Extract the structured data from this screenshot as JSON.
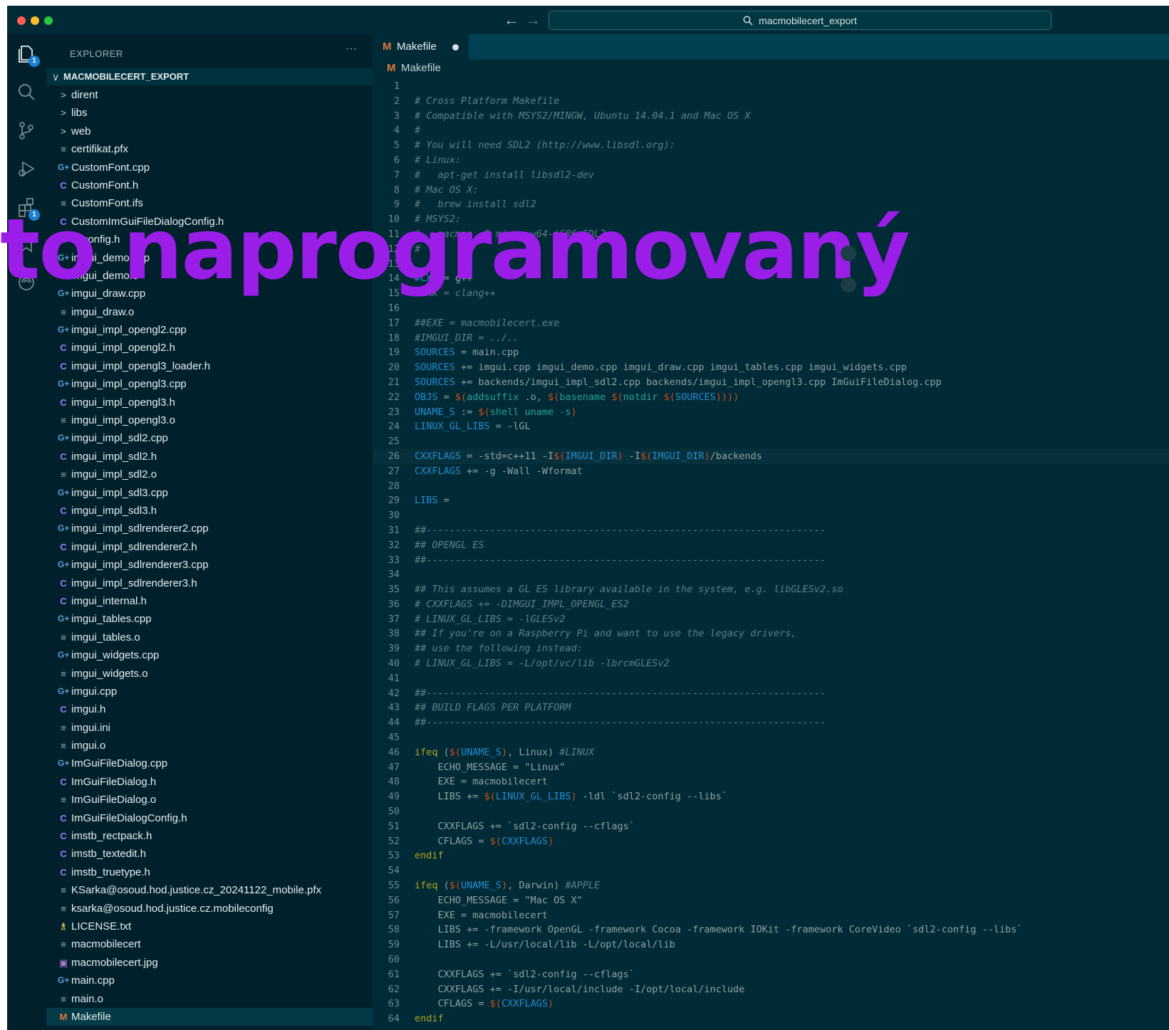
{
  "titlebar": {
    "search_text": "macmobilecert_export",
    "colors": {
      "close": "#ff5f57",
      "minimize": "#febc2e",
      "zoom": "#28c840"
    }
  },
  "activity_bar": {
    "items": [
      {
        "icon": "files-icon",
        "badge": "1"
      },
      {
        "icon": "search-icon"
      },
      {
        "icon": "source-control-icon"
      },
      {
        "icon": "run-debug-icon"
      },
      {
        "icon": "extensions-icon",
        "badge": "1"
      },
      {
        "icon": "bookmark-icon"
      },
      {
        "icon": "remote-icon"
      }
    ]
  },
  "sidebar": {
    "title": "EXPLORER",
    "more": "···",
    "root": "MACMOBILECERT_EXPORT",
    "files": [
      {
        "type": "folder",
        "icon": ">",
        "name": "dirent"
      },
      {
        "type": "folder",
        "icon": ">",
        "name": "libs"
      },
      {
        "type": "folder",
        "icon": ">",
        "name": "web"
      },
      {
        "type": "txt",
        "icon": "≡",
        "name": "certifikat.pfx"
      },
      {
        "type": "cpp",
        "icon": "G+",
        "name": "CustomFont.cpp"
      },
      {
        "type": "c",
        "icon": "C",
        "name": "CustomFont.h"
      },
      {
        "type": "txt",
        "icon": "≡",
        "name": "CustomFont.ifs"
      },
      {
        "type": "c",
        "icon": "C",
        "name": "CustomImGuiFileDialogConfig.h"
      },
      {
        "type": "c",
        "icon": "C",
        "name": "imconfig.h"
      },
      {
        "type": "cpp",
        "icon": "G+",
        "name": "imgui_demo.cpp"
      },
      {
        "type": "txt",
        "icon": "≡",
        "name": "imgui_demo.o"
      },
      {
        "type": "cpp",
        "icon": "G+",
        "name": "imgui_draw.cpp"
      },
      {
        "type": "txt",
        "icon": "≡",
        "name": "imgui_draw.o"
      },
      {
        "type": "cpp",
        "icon": "G+",
        "name": "imgui_impl_opengl2.cpp"
      },
      {
        "type": "c",
        "icon": "C",
        "name": "imgui_impl_opengl2.h"
      },
      {
        "type": "c",
        "icon": "C",
        "name": "imgui_impl_opengl3_loader.h"
      },
      {
        "type": "cpp",
        "icon": "G+",
        "name": "imgui_impl_opengl3.cpp"
      },
      {
        "type": "c",
        "icon": "C",
        "name": "imgui_impl_opengl3.h"
      },
      {
        "type": "txt",
        "icon": "≡",
        "name": "imgui_impl_opengl3.o"
      },
      {
        "type": "cpp",
        "icon": "G+",
        "name": "imgui_impl_sdl2.cpp"
      },
      {
        "type": "c",
        "icon": "C",
        "name": "imgui_impl_sdl2.h"
      },
      {
        "type": "txt",
        "icon": "≡",
        "name": "imgui_impl_sdl2.o"
      },
      {
        "type": "cpp",
        "icon": "G+",
        "name": "imgui_impl_sdl3.cpp"
      },
      {
        "type": "c",
        "icon": "C",
        "name": "imgui_impl_sdl3.h"
      },
      {
        "type": "cpp",
        "icon": "G+",
        "name": "imgui_impl_sdlrenderer2.cpp"
      },
      {
        "type": "c",
        "icon": "C",
        "name": "imgui_impl_sdlrenderer2.h"
      },
      {
        "type": "cpp",
        "icon": "G+",
        "name": "imgui_impl_sdlrenderer3.cpp"
      },
      {
        "type": "c",
        "icon": "C",
        "name": "imgui_impl_sdlrenderer3.h"
      },
      {
        "type": "c",
        "icon": "C",
        "name": "imgui_internal.h"
      },
      {
        "type": "cpp",
        "icon": "G+",
        "name": "imgui_tables.cpp"
      },
      {
        "type": "txt",
        "icon": "≡",
        "name": "imgui_tables.o"
      },
      {
        "type": "cpp",
        "icon": "G+",
        "name": "imgui_widgets.cpp"
      },
      {
        "type": "txt",
        "icon": "≡",
        "name": "imgui_widgets.o"
      },
      {
        "type": "cpp",
        "icon": "G+",
        "name": "imgui.cpp"
      },
      {
        "type": "c",
        "icon": "C",
        "name": "imgui.h"
      },
      {
        "type": "txt",
        "icon": "≡",
        "name": "imgui.ini"
      },
      {
        "type": "txt",
        "icon": "≡",
        "name": "imgui.o"
      },
      {
        "type": "cpp",
        "icon": "G+",
        "name": "ImGuiFileDialog.cpp"
      },
      {
        "type": "c",
        "icon": "C",
        "name": "ImGuiFileDialog.h"
      },
      {
        "type": "txt",
        "icon": "≡",
        "name": "ImGuiFileDialog.o"
      },
      {
        "type": "c",
        "icon": "C",
        "name": "ImGuiFileDialogConfig.h"
      },
      {
        "type": "c",
        "icon": "C",
        "name": "imstb_rectpack.h"
      },
      {
        "type": "c",
        "icon": "C",
        "name": "imstb_textedit.h"
      },
      {
        "type": "c",
        "icon": "C",
        "name": "imstb_truetype.h"
      },
      {
        "type": "txt",
        "icon": "≡",
        "name": "KSarka@osoud.hod.justice.cz_20241122_mobile.pfx"
      },
      {
        "type": "txt",
        "icon": "≡",
        "name": "ksarka@osoud.hod.justice.cz.mobileconfig"
      },
      {
        "type": "lic",
        "icon": "♗",
        "name": "LICENSE.txt"
      },
      {
        "type": "txt",
        "icon": "≡",
        "name": "macmobilecert"
      },
      {
        "type": "img",
        "icon": "▣",
        "name": "macmobilecert.jpg"
      },
      {
        "type": "cpp",
        "icon": "G+",
        "name": "main.cpp"
      },
      {
        "type": "txt",
        "icon": "≡",
        "name": "main.o"
      },
      {
        "type": "mk",
        "icon": "M",
        "name": "Makefile",
        "active": true
      }
    ]
  },
  "tab": {
    "icon": "M",
    "label": "Makefile",
    "dirty": true
  },
  "breadcrumb": {
    "icon": "M",
    "label": "Makefile"
  },
  "editor": {
    "lines": [
      {
        "n": "1",
        "t": []
      },
      {
        "n": "2",
        "t": [
          [
            "cm",
            "# Cross Platform Makefile"
          ]
        ]
      },
      {
        "n": "3",
        "t": [
          [
            "cm",
            "# Compatible with MSYS2/MINGW, Ubuntu 14.04.1 and Mac OS X"
          ]
        ]
      },
      {
        "n": "4",
        "t": [
          [
            "cm",
            "#"
          ]
        ]
      },
      {
        "n": "5",
        "t": [
          [
            "cm",
            "# You will need SDL2 (http://www.libsdl.org):"
          ]
        ]
      },
      {
        "n": "6",
        "t": [
          [
            "cm",
            "# Linux:"
          ]
        ]
      },
      {
        "n": "7",
        "t": [
          [
            "cm",
            "#   apt-get install libsdl2-dev"
          ]
        ]
      },
      {
        "n": "8",
        "t": [
          [
            "cm",
            "# Mac OS X:"
          ]
        ]
      },
      {
        "n": "9",
        "t": [
          [
            "cm",
            "#   brew install sdl2"
          ]
        ]
      },
      {
        "n": "10",
        "t": [
          [
            "cm",
            "# MSYS2:"
          ]
        ]
      },
      {
        "n": "11",
        "t": [
          [
            "cm",
            "#   pacman -S mingw-w64-i686-SDL2"
          ]
        ]
      },
      {
        "n": "12",
        "t": [
          [
            "cm",
            "#"
          ]
        ]
      },
      {
        "n": "13",
        "t": []
      },
      {
        "n": "14",
        "t": [
          [
            "vr",
            "#CXX"
          ],
          [
            "st",
            " = g++"
          ]
        ]
      },
      {
        "n": "15",
        "t": [
          [
            "cm",
            "#CXX = clang++"
          ]
        ]
      },
      {
        "n": "16",
        "t": []
      },
      {
        "n": "17",
        "t": [
          [
            "cm",
            "##EXE = macmobilecert.exe"
          ]
        ]
      },
      {
        "n": "18",
        "t": [
          [
            "cm",
            "#IMGUI_DIR = ../.."
          ]
        ]
      },
      {
        "n": "19",
        "t": [
          [
            "vr",
            "SOURCES"
          ],
          [
            "st",
            " = main.cpp"
          ]
        ]
      },
      {
        "n": "20",
        "t": [
          [
            "vr",
            "SOURCES"
          ],
          [
            "st",
            " += imgui.cpp imgui_demo.cpp imgui_draw.cpp imgui_tables.cpp imgui_widgets.cpp"
          ]
        ]
      },
      {
        "n": "21",
        "t": [
          [
            "vr",
            "SOURCES"
          ],
          [
            "st",
            " += backends/imgui_impl_sdl2.cpp backends/imgui_impl_opengl3.cpp ImGuiFileDialog.cpp"
          ]
        ]
      },
      {
        "n": "22",
        "t": [
          [
            "vr",
            "OBJS"
          ],
          [
            "st",
            " = "
          ],
          [
            "dl",
            "$("
          ],
          [
            "fn",
            "addsuffix"
          ],
          [
            "st",
            " .o, "
          ],
          [
            "dl",
            "$("
          ],
          [
            "fn",
            "basename"
          ],
          [
            "st",
            " "
          ],
          [
            "dl",
            "$("
          ],
          [
            "fn",
            "notdir"
          ],
          [
            "st",
            " "
          ],
          [
            "dl",
            "$("
          ],
          [
            "vr",
            "SOURCES"
          ],
          [
            "dl",
            "))))"
          ]
        ]
      },
      {
        "n": "23",
        "t": [
          [
            "vr",
            "UNAME_S"
          ],
          [
            "st",
            " := "
          ],
          [
            "dl",
            "$("
          ],
          [
            "fn",
            "shell uname -s"
          ],
          [
            "dl",
            ")"
          ]
        ]
      },
      {
        "n": "24",
        "t": [
          [
            "vr",
            "LINUX_GL_LIBS"
          ],
          [
            "st",
            " = -lGL"
          ]
        ]
      },
      {
        "n": "25",
        "t": []
      },
      {
        "n": "26",
        "t": [
          [
            "vr",
            "CXXFLAGS"
          ],
          [
            "st",
            " = -std=c++11 -I"
          ],
          [
            "dl",
            "$("
          ],
          [
            "vr",
            "IMGUI_DIR"
          ],
          [
            "dl",
            ")"
          ],
          [
            "st",
            " -I"
          ],
          [
            "dl",
            "$("
          ],
          [
            "vr",
            "IMGUI_DIR"
          ],
          [
            "dl",
            ")"
          ],
          [
            "st",
            "/backends"
          ]
        ],
        "hl": true
      },
      {
        "n": "27",
        "t": [
          [
            "vr",
            "CXXFLAGS"
          ],
          [
            "st",
            " += -g -Wall -Wformat"
          ]
        ]
      },
      {
        "n": "28",
        "t": []
      },
      {
        "n": "29",
        "t": [
          [
            "vr",
            "LIBS"
          ],
          [
            "st",
            " ="
          ]
        ]
      },
      {
        "n": "30",
        "t": []
      },
      {
        "n": "31",
        "t": [
          [
            "cm",
            "##---------------------------------------------------------------------"
          ]
        ]
      },
      {
        "n": "32",
        "t": [
          [
            "cm",
            "## OPENGL ES"
          ]
        ]
      },
      {
        "n": "33",
        "t": [
          [
            "cm",
            "##---------------------------------------------------------------------"
          ]
        ]
      },
      {
        "n": "34",
        "t": []
      },
      {
        "n": "35",
        "t": [
          [
            "cm",
            "## This assumes a GL ES library available in the system, e.g. libGLESv2.so"
          ]
        ]
      },
      {
        "n": "36",
        "t": [
          [
            "cm",
            "# CXXFLAGS += -DIMGUI_IMPL_OPENGL_ES2"
          ]
        ]
      },
      {
        "n": "37",
        "t": [
          [
            "cm",
            "# LINUX_GL_LIBS = -lGLESv2"
          ]
        ]
      },
      {
        "n": "38",
        "t": [
          [
            "cm",
            "## If you're on a Raspberry Pi and want to use the legacy drivers,"
          ]
        ]
      },
      {
        "n": "39",
        "t": [
          [
            "cm",
            "## use the following instead:"
          ]
        ]
      },
      {
        "n": "40",
        "t": [
          [
            "cm",
            "# LINUX_GL_LIBS = -L/opt/vc/lib -lbrcmGLESv2"
          ]
        ]
      },
      {
        "n": "41",
        "t": []
      },
      {
        "n": "42",
        "t": [
          [
            "cm",
            "##---------------------------------------------------------------------"
          ]
        ]
      },
      {
        "n": "43",
        "t": [
          [
            "cm",
            "## BUILD FLAGS PER PLATFORM"
          ]
        ]
      },
      {
        "n": "44",
        "t": [
          [
            "cm",
            "##---------------------------------------------------------------------"
          ]
        ]
      },
      {
        "n": "45",
        "t": []
      },
      {
        "n": "46",
        "t": [
          [
            "kw",
            "ifeq"
          ],
          [
            "st",
            " ("
          ],
          [
            "dl",
            "$("
          ],
          [
            "vr",
            "UNAME_S"
          ],
          [
            "dl",
            ")"
          ],
          [
            "st",
            ", Linux) "
          ],
          [
            "cm",
            "#LINUX"
          ]
        ]
      },
      {
        "n": "47",
        "t": [
          [
            "st",
            "    ECHO_MESSAGE = \"Linux\""
          ]
        ]
      },
      {
        "n": "48",
        "t": [
          [
            "st",
            "    EXE = macmobilecert"
          ]
        ]
      },
      {
        "n": "49",
        "t": [
          [
            "st",
            "    LIBS += "
          ],
          [
            "dl",
            "$("
          ],
          [
            "vr",
            "LINUX_GL_LIBS"
          ],
          [
            "dl",
            ")"
          ],
          [
            "st",
            " -ldl `sdl2-config --libs`"
          ]
        ]
      },
      {
        "n": "50",
        "t": []
      },
      {
        "n": "51",
        "t": [
          [
            "st",
            "    CXXFLAGS += `sdl2-config --cflags`"
          ]
        ]
      },
      {
        "n": "52",
        "t": [
          [
            "st",
            "    CFLAGS = "
          ],
          [
            "dl",
            "$("
          ],
          [
            "vr",
            "CXXFLAGS"
          ],
          [
            "dl",
            ")"
          ]
        ]
      },
      {
        "n": "53",
        "t": [
          [
            "kw",
            "endif"
          ]
        ]
      },
      {
        "n": "54",
        "t": []
      },
      {
        "n": "55",
        "t": [
          [
            "kw",
            "ifeq"
          ],
          [
            "st",
            " ("
          ],
          [
            "dl",
            "$("
          ],
          [
            "vr",
            "UNAME_S"
          ],
          [
            "dl",
            ")"
          ],
          [
            "st",
            ", Darwin) "
          ],
          [
            "cm",
            "#APPLE"
          ]
        ]
      },
      {
        "n": "56",
        "t": [
          [
            "st",
            "    ECHO_MESSAGE = \"Mac OS X\""
          ]
        ]
      },
      {
        "n": "57",
        "t": [
          [
            "st",
            "    EXE = macmobilecert"
          ]
        ]
      },
      {
        "n": "58",
        "t": [
          [
            "st",
            "    LIBS += -framework OpenGL -framework Cocoa -framework IOKit -framework CoreVideo `sdl2-config --libs`"
          ]
        ]
      },
      {
        "n": "59",
        "t": [
          [
            "st",
            "    LIBS += -L/usr/local/lib -L/opt/local/lib"
          ]
        ]
      },
      {
        "n": "60",
        "t": []
      },
      {
        "n": "61",
        "t": [
          [
            "st",
            "    CXXFLAGS += `sdl2-config --cflags`"
          ]
        ]
      },
      {
        "n": "62",
        "t": [
          [
            "st",
            "    CXXFLAGS += -I/usr/local/include -I/opt/local/include"
          ]
        ]
      },
      {
        "n": "63",
        "t": [
          [
            "st",
            "    CFLAGS = "
          ],
          [
            "dl",
            "$("
          ],
          [
            "vr",
            "CXXFLAGS"
          ],
          [
            "dl",
            ")"
          ]
        ]
      },
      {
        "n": "64",
        "t": [
          [
            "kw",
            "endif"
          ]
        ]
      }
    ]
  },
  "overlay": {
    "text": "to naprogramovaný",
    "color": "#9a1ee8"
  }
}
